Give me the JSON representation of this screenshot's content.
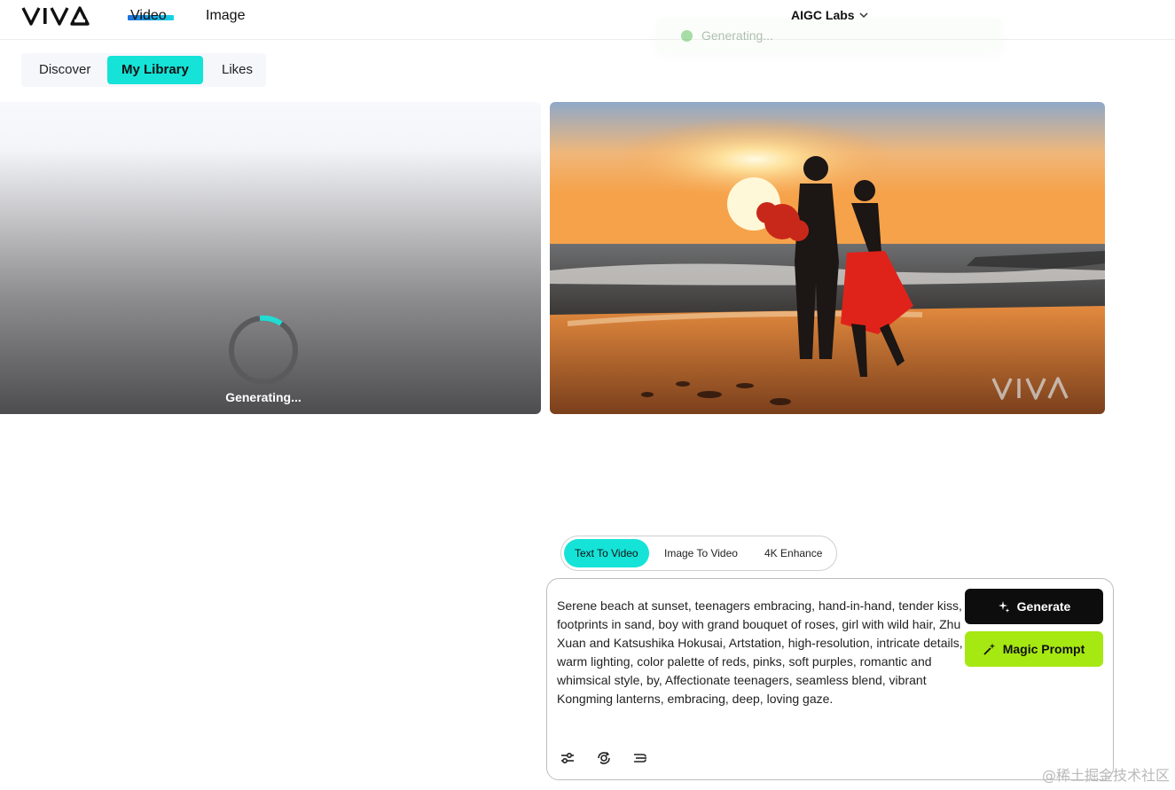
{
  "header": {
    "logo_text": "VIVA",
    "nav": [
      {
        "label": "Video",
        "active": true
      },
      {
        "label": "Image",
        "active": false
      }
    ],
    "org_name": "AIGC Labs",
    "toast_text": "Generating..."
  },
  "library_tabs": [
    {
      "label": "Discover",
      "active": false
    },
    {
      "label": "My Library",
      "active": true
    },
    {
      "label": "Likes",
      "active": false
    }
  ],
  "cards": {
    "generating_text": "Generating...",
    "video_watermark": "VIVA"
  },
  "mode_tabs": [
    {
      "label": "Text To Video",
      "active": true
    },
    {
      "label": "Image To Video",
      "active": false
    },
    {
      "label": "4K Enhance",
      "active": false
    }
  ],
  "prompt": {
    "text": "Serene beach at sunset, teenagers embracing, hand-in-hand, tender kiss, footprints in sand, boy with grand bouquet of roses, girl with wild hair, Zhu Xuan and Katsushika Hokusai, Artstation, high-resolution, intricate details, warm lighting, color palette of reds, pinks, soft purples, romantic and whimsical style, by, Affectionate teenagers, seamless blend, vibrant Kongming lanterns, embracing, deep, loving gaze."
  },
  "buttons": {
    "generate_label": "Generate",
    "magic_label": "Magic Prompt"
  },
  "tools": [
    "settings-sliders-icon",
    "camera-rotate-icon",
    "motion-icon"
  ],
  "colors": {
    "accent": "#15e3d8",
    "magic": "#a6e812",
    "generate_bg": "#0d0d0d"
  },
  "page_watermark": "@稀土掘金技术社区"
}
